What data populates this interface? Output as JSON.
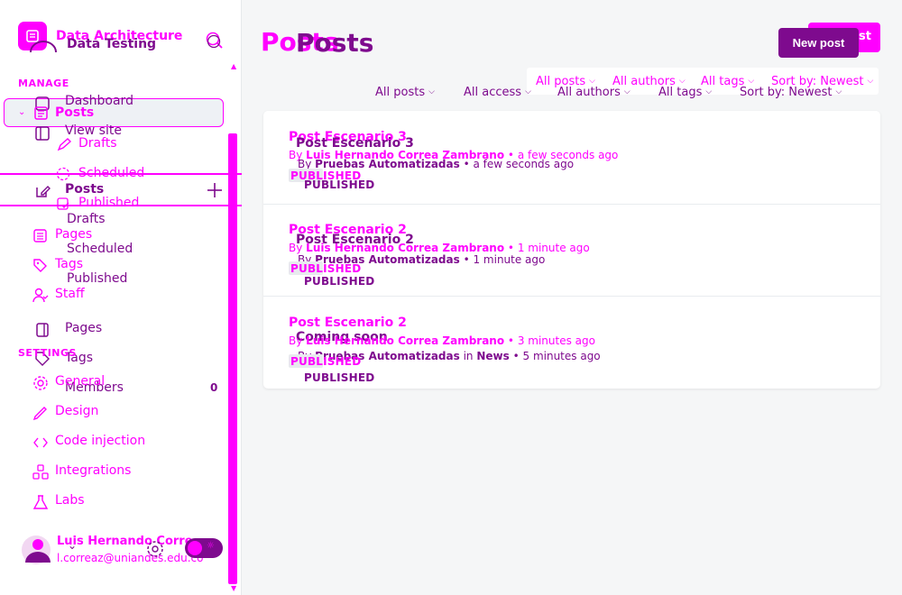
{
  "sidebar": {
    "site_title_a": "Data Architecture",
    "site_title_b": "Data Testing",
    "manage_label": "MANAGE",
    "settings_label": "SETTINGS",
    "a_items": {
      "posts": "Posts",
      "drafts": "Drafts",
      "scheduled": "Scheduled",
      "published": "Published",
      "pages": "Pages",
      "tags": "Tags",
      "staff": "Staff",
      "general": "General",
      "design": "Design",
      "code_injection": "Code injection",
      "integrations": "Integrations",
      "labs": "Labs"
    },
    "b_items": {
      "dashboard": "Dashboard",
      "view_site": "View site",
      "posts": "Posts",
      "drafts": "Drafts",
      "scheduled": "Scheduled",
      "published": "Published",
      "pages": "Pages",
      "tags": "Tags",
      "members": "Members",
      "members_count": "0"
    },
    "user": {
      "name": "Luis Hernando Corre",
      "email": "l.correaz@uniandes.edu.co"
    }
  },
  "header": {
    "title_a": "Posts",
    "title_b": "Posts",
    "new_post_a": "New post",
    "new_post_b": "New post"
  },
  "filters_a": {
    "all_posts": "All posts",
    "all_authors": "All authors",
    "all_tags": "All tags",
    "sort": "Sort by: Newest"
  },
  "filters_b": {
    "all_posts": "All posts",
    "all_access": "All access",
    "all_authors": "All authors",
    "all_tags": "All tags",
    "sort": "Sort by: Newest"
  },
  "posts_a": [
    {
      "title": "Post Escenario 3",
      "by": "By",
      "author": "Luis Hernando Correa Zambrano",
      "time": "• a few seconds ago",
      "status": "PUBLISHED"
    },
    {
      "title": "Post Escenario 2",
      "by": "By",
      "author": "Luis Hernando Correa Zambrano",
      "time": "• 1 minute ago",
      "status": "PUBLISHED"
    },
    {
      "title": "Post Escenario 2",
      "by": "By",
      "author": "Luis Hernando Correa Zambrano",
      "time": "• 3 minutes ago",
      "status": "PUBLISHED"
    }
  ],
  "posts_b": [
    {
      "title": "Post Escenario 3",
      "by": "By",
      "author": "Pruebas Automatizadas",
      "time": "• a few seconds ago",
      "status": "PUBLISHED"
    },
    {
      "title": "Post Escenario 2",
      "by": "By",
      "author": "Pruebas Automatizadas",
      "time": "• 1 minute ago",
      "status": "PUBLISHED"
    },
    {
      "title": "Coming soon",
      "by": "By",
      "author": "Pruebas Automatizadas",
      "in": "in",
      "tag": "News",
      "time": "• 5 minutes ago",
      "status": "PUBLISHED"
    }
  ],
  "colors": {
    "accent_a": "#ff00ff",
    "accent_b": "#7e0a8e"
  }
}
